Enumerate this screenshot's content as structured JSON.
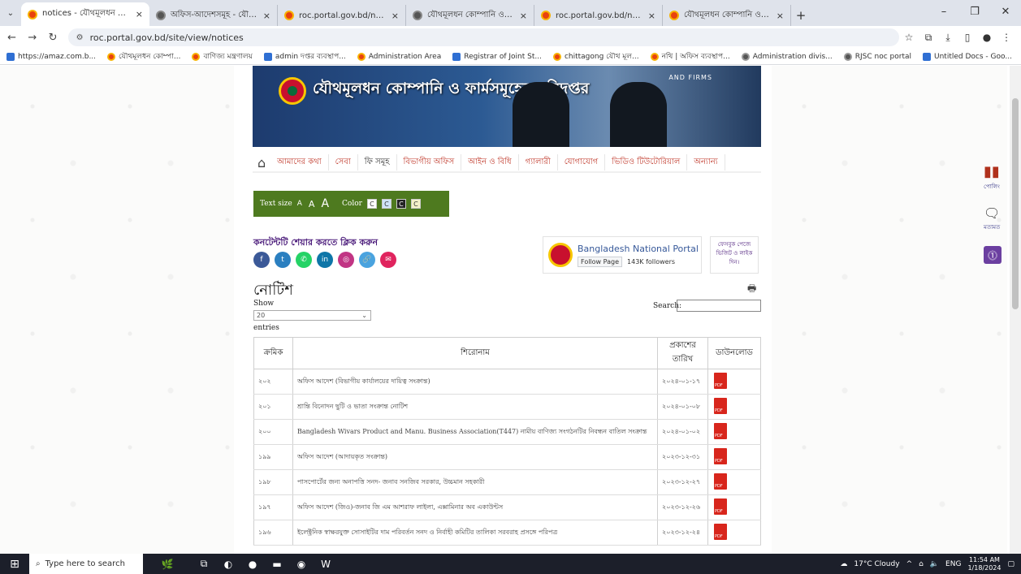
{
  "browser": {
    "tabs": [
      {
        "title": "notices - যৌথমূলধন কোম্পানি ও",
        "active": true
      },
      {
        "title": "অফিস-আদেশসমূহ - যৌথমূলধ",
        "active": false
      },
      {
        "title": "roc.portal.gov.bd/npfadmin/pu",
        "active": false
      },
      {
        "title": "যৌথমূলধন কোম্পানি ও ফার্মসমূ",
        "active": false
      },
      {
        "title": "roc.portal.gov.bd/npfadmin/pu",
        "active": false
      },
      {
        "title": "যৌথমূলধন কোম্পানি ও ফার্মসমূ",
        "active": false
      }
    ],
    "url": "roc.portal.gov.bd/site/view/notices",
    "bookmarks": [
      "https://amaz.com.b...",
      "যৌথমূলধন কোম্পা...",
      "বাণিজ্য মন্ত্রণালয়",
      "admin দপ্তর ব্যবস্থাপ...",
      "Administration Area",
      "Registrar of Joint St...",
      "chittagong যৌথ মূল...",
      "নথি | অফিস ব্যবস্থাপ...",
      "Administration divis...",
      "RJSC noc portal",
      "Untitled Docs - Goo..."
    ]
  },
  "site": {
    "banner_title": "যৌথমূলধন কোম্পানি ও ফার্মসমূহের পরিদপ্তর",
    "banner_sub": "AND FIRMS",
    "menu": [
      "আমাদের কথা",
      "সেবা",
      "ফি সমূহ",
      "বিভাগীয় অফিস",
      "আইন ও বিধি",
      "গ্যালারী",
      "যোগাযোগ",
      "ভিডিও টিউটোরিয়াল",
      "অন্যান্য"
    ],
    "access": {
      "text_size": "Text size",
      "a_small": "A",
      "a_mid": "A",
      "a_large": "A",
      "color": "Color",
      "c": "C"
    },
    "share_title": "কনটেন্টটি শেয়ার করতে ক্লিক করুন",
    "portal_name": "Bangladesh National Portal",
    "follow_page": "Follow Page",
    "followers": "143K followers",
    "fb_note": "ফেসবুক পেজে ভিজিট ও লাইক দিন।",
    "page_title": "নোটিশ",
    "show_label": "Show",
    "show_value": "20",
    "entries_label": "entries",
    "search_label": "Search:"
  },
  "table": {
    "headers": [
      "ক্রমিক",
      "শিরোনাম",
      "প্রকাশের তারিখ",
      "ডাউনলোড"
    ],
    "rows": [
      {
        "sl": "২০২",
        "title": "অফিস আদেশ (বিভাগীয় কার্যালয়ের দায়িত্ব সংক্রান্ত)",
        "date": "২০২৪-০১-১৭"
      },
      {
        "sl": "২০১",
        "title": "শ্রান্তি বিনোদন ছুটি ও ভাতা সংক্রান্ত নোটিশ",
        "date": "২০২৪-০১-০৮"
      },
      {
        "sl": "২০০",
        "title": "Bangladesh Wivars Product and Manu. Business Association(T447) নামীয় বাণিজ্য সংগঠনটির নিবন্ধন বাতিল সংক্রান্ত",
        "date": "২০২৪-০১-০২"
      },
      {
        "sl": "১৯৯",
        "title": "অফিস আদেশ (আদায়কৃত সংক্রান্ত)",
        "date": "২০২৩-১২-৩১"
      },
      {
        "sl": "১৯৮",
        "title": "পাসপোর্টের জন্য অনাপত্তি সনদ- জনাব সনজিব সরকার, উচ্চমান সহকারী",
        "date": "২০২৩-১২-২৭"
      },
      {
        "sl": "১৯৭",
        "title": "অফিস আদেশ (জিও)-জনাব জি এম আশরাফ লাইলা, এক্সামিনার অব একাউন্টস",
        "date": "২০২৩-১২-২৬"
      },
      {
        "sl": "১৯৬",
        "title": "ইলেক্ট্রনিক স্বাক্ষরযুক্ত সোসাইটির দাম পরিবর্তন সনদ ও নির্বাহী কমিটির তালিকা সরবরাহ প্রসঙ্গে পরিপত্র",
        "date": "২০২৩-১২-২৪"
      }
    ]
  },
  "sidewidgets": {
    "poll": "পোলিং",
    "feedback": "মতামত"
  },
  "taskbar": {
    "search_placeholder": "Type here to search",
    "weather": "17°C  Cloudy",
    "lang": "ENG",
    "time": "11:54 AM",
    "date": "1/18/2024"
  }
}
